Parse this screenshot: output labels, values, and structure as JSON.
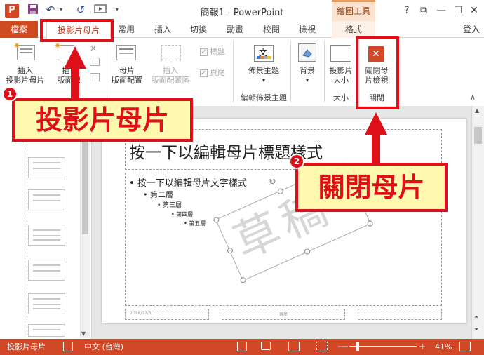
{
  "title_bar": {
    "app_title": "簡報1 - PowerPoint",
    "context_tab_group": "繪圖工具",
    "help": "?",
    "restore": "⧉",
    "minimize": "—",
    "maximize": "☐",
    "close": "✕"
  },
  "quick_access": {
    "redo": "↺"
  },
  "tabs": [
    "檔案",
    "投影片母片",
    "常用",
    "插入",
    "切換",
    "動畫",
    "校閱",
    "檢視",
    "格式"
  ],
  "sign_in": "登入",
  "ribbon": {
    "insert_master": [
      "插入",
      "投影片母片"
    ],
    "insert_layout": [
      "插",
      "版面配"
    ],
    "layout": [
      "母片",
      "版面配置"
    ],
    "insert_placeholder": [
      "插入",
      "版面配置區"
    ],
    "title_checkbox": "標題",
    "footer_checkbox": "頁尾",
    "themes": "佈景主題",
    "background": "背景",
    "slide_size": [
      "投影片",
      "大小"
    ],
    "close_master": [
      "關閉母",
      "片檢視"
    ],
    "group_edit_theme": "編輯佈景主題",
    "group_size": "大小",
    "group_close": "關閉",
    "font_sample": "文"
  },
  "slide": {
    "title": "按一下以編輯母片標題樣式",
    "bullets": [
      "按一下以編輯母片文字樣式",
      "第二層",
      "第三層",
      "第四層",
      "第五層"
    ],
    "watermark": "草稿",
    "footer_date": "2018/12/3",
    "footer_text": "頁尾"
  },
  "status_bar": {
    "view_name": "投影片母片",
    "language": "中文 (台灣)",
    "zoom": "41%"
  },
  "annotations": {
    "callout_1": "投影片母片",
    "callout_2": "關閉母片",
    "badge_1": "1",
    "badge_2": "2"
  },
  "colors": {
    "accent": "#d24726",
    "annotation": "#e0101a",
    "callout_fill": "#fff9b0"
  }
}
